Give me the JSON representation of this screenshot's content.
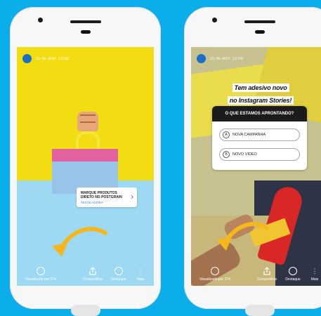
{
  "left_phone": {
    "header": {
      "date": "25 de abril",
      "time": "12:08"
    },
    "product_tag": {
      "title": "MARQUE PRODUTOS DIRETO NO POSTGRAIN",
      "cta": "TESTE AGORA",
      "chevron": "›"
    },
    "actions": [
      {
        "label": "Visualizado por 274",
        "icon": "viewers-icon"
      },
      {
        "label": "Compartilhar",
        "icon": "share-icon"
      },
      {
        "label": "Destaque",
        "icon": "highlight-icon"
      },
      {
        "label": "Mais",
        "icon": "more-icon"
      }
    ]
  },
  "right_phone": {
    "header": {
      "date": "25 de abril",
      "time": "12:08"
    },
    "title_lines": [
      "Tem adesivo novo",
      "no Instagram Stories!"
    ],
    "poll": {
      "question": "O QUE ESTAMOS APRONTANDO?",
      "options": [
        {
          "letter": "A",
          "label": "NOVA CAMPANHA"
        },
        {
          "letter": "B",
          "label": "NOVO VÍDEO"
        }
      ]
    },
    "actions": [
      {
        "label": "Visualizado por 274",
        "icon": "viewers-icon"
      },
      {
        "label": "Compartilhar",
        "icon": "share-icon"
      },
      {
        "label": "Destaque",
        "icon": "highlight-icon"
      },
      {
        "label": "Mais",
        "icon": "more-icon"
      }
    ]
  },
  "colors": {
    "background": "#0aaeea",
    "arrow": "#f5b71c",
    "yellow": "#f2dc12",
    "light_blue": "#9ed9f3"
  }
}
